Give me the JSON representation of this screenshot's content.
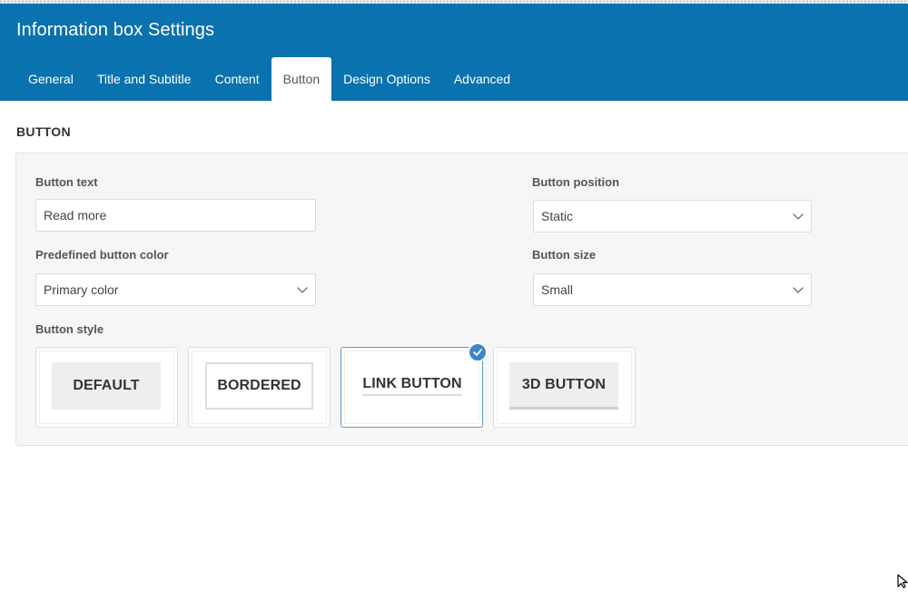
{
  "window": {
    "title": "Information box Settings"
  },
  "tabs": [
    {
      "label": "General",
      "active": false
    },
    {
      "label": "Title and Subtitle",
      "active": false
    },
    {
      "label": "Content",
      "active": false
    },
    {
      "label": "Button",
      "active": true
    },
    {
      "label": "Design Options",
      "active": false
    },
    {
      "label": "Advanced",
      "active": false
    }
  ],
  "section": {
    "title": "BUTTON"
  },
  "fields": {
    "button_text": {
      "label": "Button text",
      "value": "Read more"
    },
    "button_position": {
      "label": "Button position",
      "value": "Static"
    },
    "predefined_color": {
      "label": "Predefined button color",
      "value": "Primary color"
    },
    "button_size": {
      "label": "Button size",
      "value": "Small"
    },
    "button_style": {
      "label": "Button style",
      "options": [
        {
          "label": "DEFAULT",
          "selected": false
        },
        {
          "label": "BORDERED",
          "selected": false
        },
        {
          "label": "LINK BUTTON",
          "selected": true
        },
        {
          "label": "3D BUTTON",
          "selected": false
        }
      ]
    }
  },
  "colors": {
    "header_bg": "#0a72ae",
    "selected_accent": "#3d86c6"
  },
  "icons": {
    "select_arrow": "chevron-down-icon",
    "selected_mark": "check-icon",
    "pointer": "mouse-cursor-icon"
  }
}
